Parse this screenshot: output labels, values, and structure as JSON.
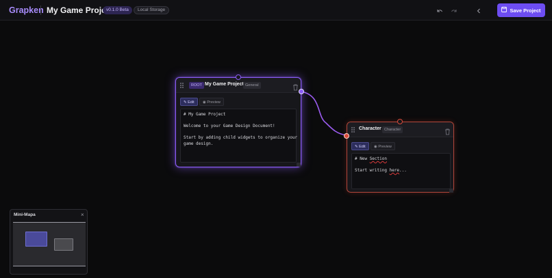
{
  "header": {
    "brand": "Grapken",
    "project_title": "My Game Project",
    "version_badge": "v0.1.0 Beta",
    "storage_badge": "Local Storage",
    "save_label": "Save Project"
  },
  "nodes": {
    "root": {
      "tag": "ROOT",
      "title": "My Game Project",
      "type": "General",
      "edit_label": "Edit",
      "preview_label": "Preview",
      "lines": [
        "# My Game Project",
        "",
        "Welcome to your Game Design Document!",
        "",
        "Start by adding child widgets to organize your",
        "game design."
      ]
    },
    "character": {
      "title": "Character",
      "type": "Character",
      "edit_label": "Edit",
      "preview_label": "Preview",
      "line1_a": "# New ",
      "line1_b": "Section",
      "line2_a": "Start writing ",
      "line2_b": "here",
      "line2_c": "..."
    }
  },
  "minimap": {
    "title": "Mini-Mapa",
    "close": "×"
  },
  "colors": {
    "accent": "#8b5cf6",
    "save": "#6d4df2",
    "child_border": "#b3473b",
    "edge": "#9b5cf0"
  }
}
